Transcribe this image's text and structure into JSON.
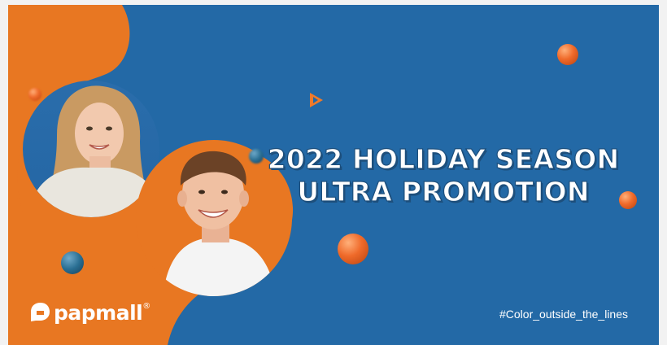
{
  "banner": {
    "headline_line1": "2022 HOLIDAY SEASON",
    "headline_line2": "ULTRA PROMOTION",
    "hashtag": "#Color_outside_the_lines",
    "brand_name": "papmall",
    "brand_registered_mark": "®",
    "colors": {
      "background_blue": "#2369a6",
      "accent_orange": "#e87722",
      "text_white": "#ffffff"
    },
    "icons": [
      "play-icon",
      "papmall-logo-icon"
    ]
  }
}
